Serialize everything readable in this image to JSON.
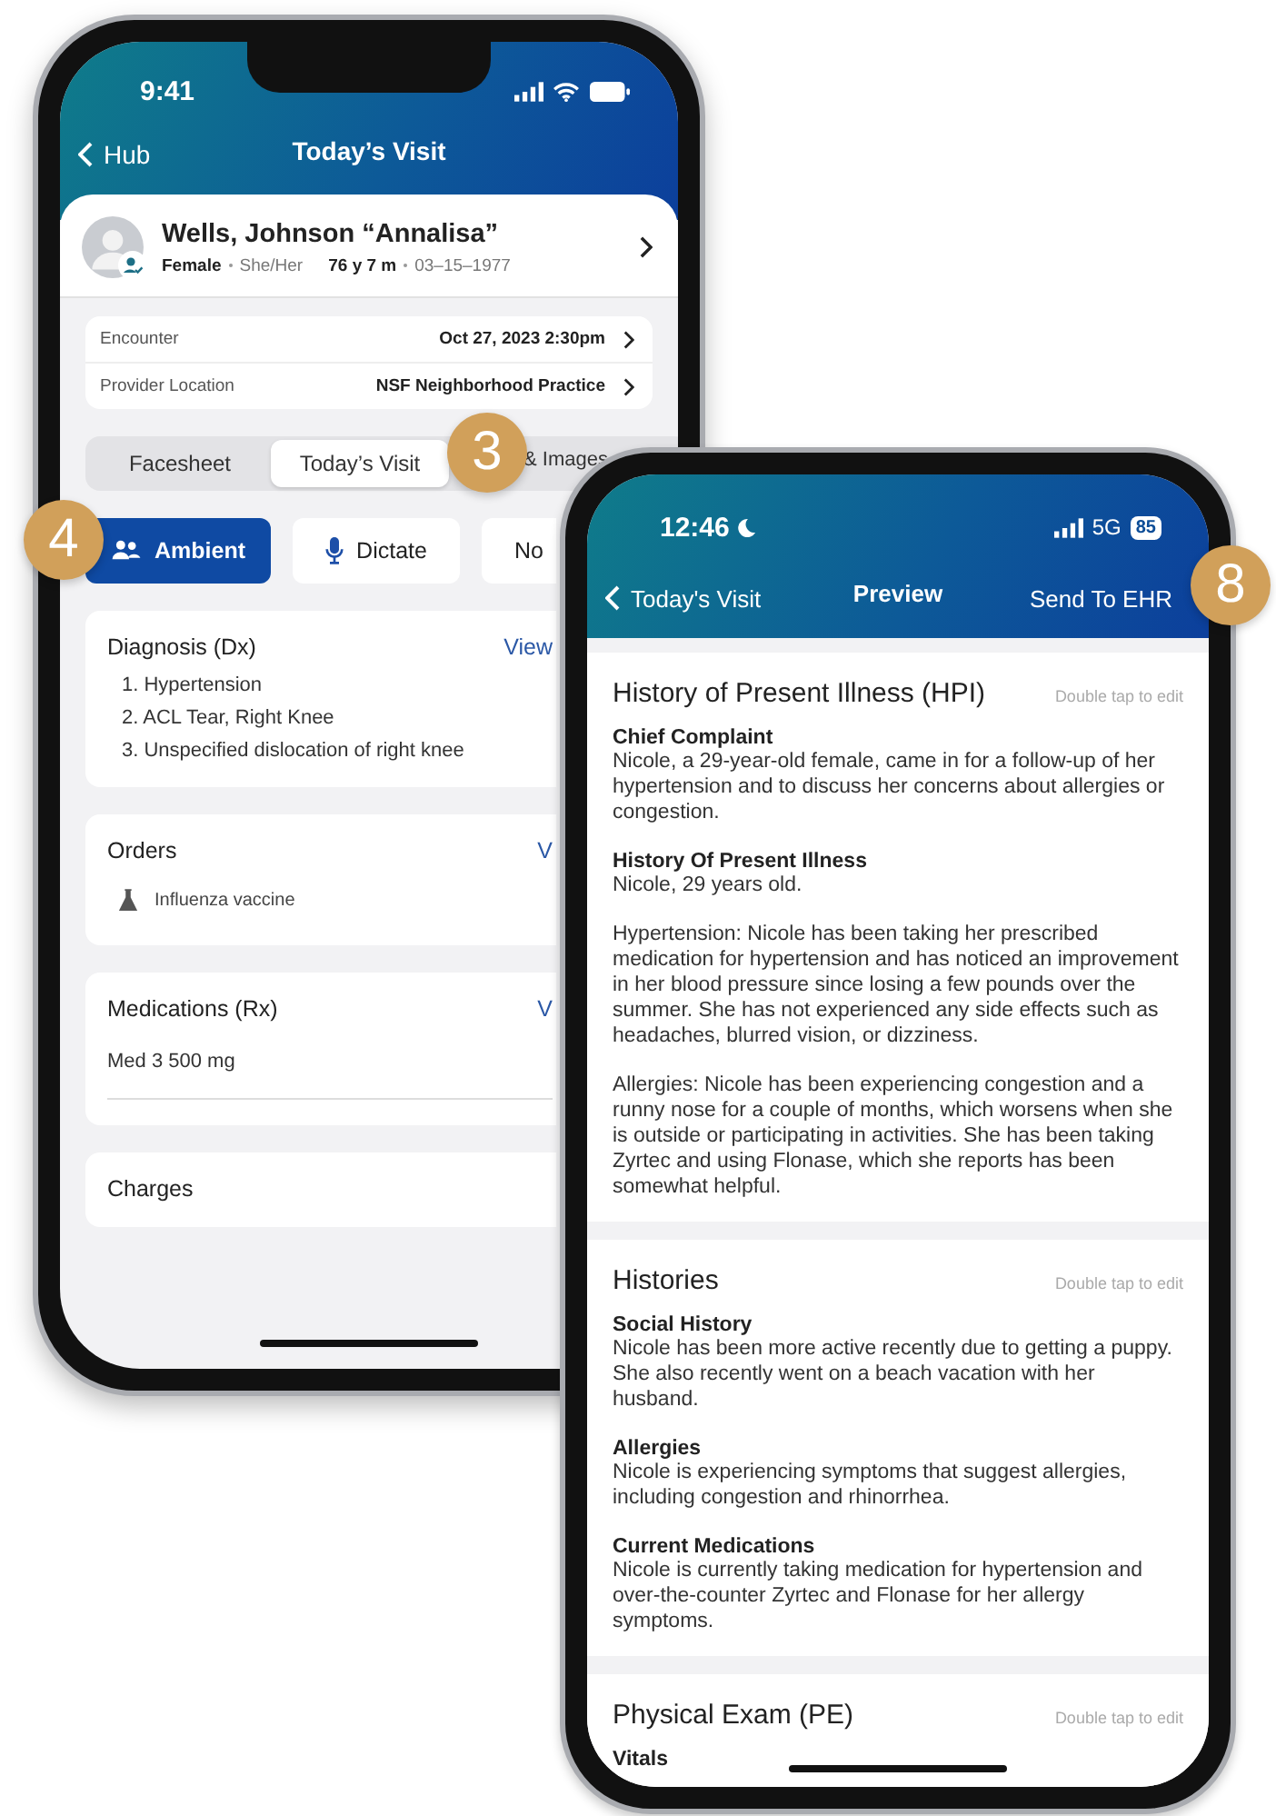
{
  "visit_screen": {
    "status_bar": {
      "time": "9:41"
    },
    "nav": {
      "back": "Hub",
      "title": "Today’s Visit"
    },
    "patient": {
      "name": "Wells, Johnson “Annalisa”",
      "sex": "Female",
      "pronouns": "She/Her",
      "age": "76 y 7 m",
      "dob": "03–15–1977"
    },
    "details": [
      {
        "label": "Encounter",
        "value": "Oct 27, 2023 2:30pm"
      },
      {
        "label": "Provider Location",
        "value": "NSF Neighborhood Practice"
      }
    ],
    "tabs": [
      {
        "label": "Facesheet",
        "selected": false
      },
      {
        "label": "Today’s Visit",
        "selected": true
      },
      {
        "label": "& Images",
        "selected": false
      }
    ],
    "modes": [
      {
        "label": "Ambient",
        "kind": "people",
        "selected": true
      },
      {
        "label": "Dictate",
        "kind": "mic",
        "selected": false
      },
      {
        "label": "No",
        "kind": "text",
        "selected": false
      }
    ],
    "cards": [
      {
        "title": "Diagnosis (Dx)",
        "link": "View",
        "kind": "list",
        "items": [
          "1. Hypertension",
          "2. ACL Tear, Right Knee",
          "3. Unspecified dislocation of right knee"
        ]
      },
      {
        "title": "Orders",
        "link": "V",
        "kind": "orders",
        "items": [
          "Influenza vaccine"
        ]
      },
      {
        "title": "Medications (Rx)",
        "link": "V",
        "kind": "meds",
        "items": [
          "Med 3 500 mg"
        ]
      },
      {
        "title": "Charges",
        "kind": "plain"
      }
    ]
  },
  "preview_screen": {
    "status_bar": {
      "time": "12:46",
      "network": "5G",
      "battery": "85"
    },
    "nav": {
      "back": "Today's Visit",
      "title": "Preview",
      "action": "Send To EHR"
    },
    "sections": [
      {
        "title": "History of Present Illness (HPI)",
        "hint": "Double tap to edit",
        "blocks": [
          {
            "heading": "Chief Complaint",
            "paragraphs": [
              "Nicole, a 29-year-old female, came in for a follow-up of her hypertension and to discuss her concerns about allergies or congestion."
            ]
          },
          {
            "heading": "History Of Present Illness",
            "paragraphs": [
              "Nicole, 29 years old.",
              "Hypertension: Nicole has been taking her prescribed medication for hypertension and has noticed an improvement in her blood pressure since losing a few pounds over the summer. She has not experienced any side effects such as headaches, blurred vision, or dizziness.",
              "Allergies: Nicole has been experiencing congestion and a runny nose for a couple of months, which worsens when she is outside or participating in activities. She has been taking Zyrtec and using Flonase, which she reports has been somewhat helpful."
            ]
          }
        ]
      },
      {
        "title": "Histories",
        "hint": "Double tap to edit",
        "blocks": [
          {
            "heading": "Social History",
            "paragraphs": [
              "Nicole has been more active recently due to getting a puppy. She also recently went on a beach vacation with her husband."
            ]
          },
          {
            "heading": "Allergies",
            "paragraphs": [
              "Nicole is experiencing symptoms that suggest allergies, including congestion and rhinorrhea."
            ]
          },
          {
            "heading": "Current Medications",
            "paragraphs": [
              "Nicole is currently taking medication for hypertension and over-the-counter Zyrtec and Flonase for her allergy symptoms."
            ]
          }
        ]
      },
      {
        "title": "Physical Exam (PE)",
        "hint": "Double tap to edit",
        "blocks": [
          {
            "heading": "Vitals"
          }
        ]
      }
    ]
  },
  "callouts": [
    {
      "label": "3"
    },
    {
      "label": "4"
    },
    {
      "label": "8"
    }
  ]
}
